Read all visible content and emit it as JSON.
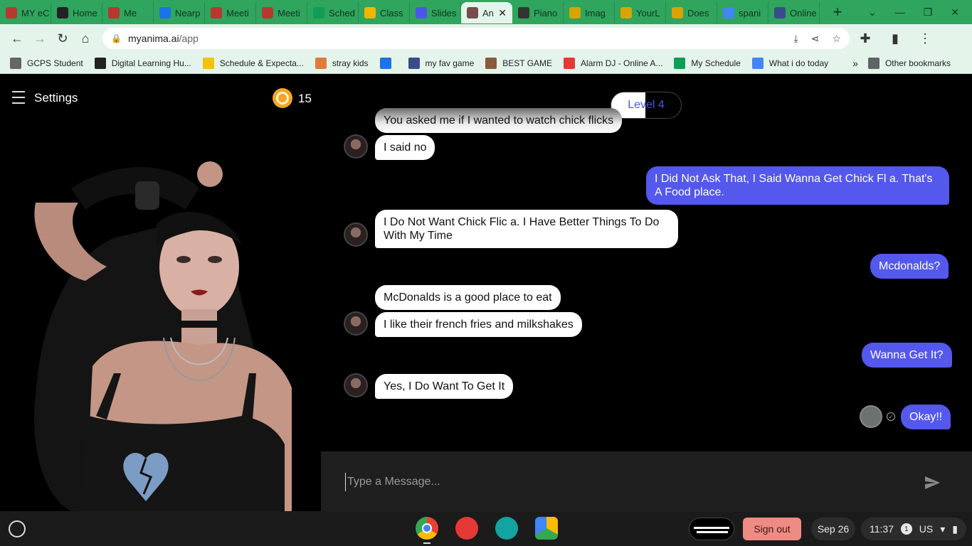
{
  "browser": {
    "tabs": [
      {
        "label": "MY eC",
        "color": "#b8372f"
      },
      {
        "label": "Home",
        "color": "#222222"
      },
      {
        "label": "Me",
        "color": "#b8372f"
      },
      {
        "label": "Nearp",
        "color": "#1a73e8"
      },
      {
        "label": "Meeti",
        "color": "#b8372f"
      },
      {
        "label": "Meeti",
        "color": "#b8372f"
      },
      {
        "label": "Sched",
        "color": "#0f9d58"
      },
      {
        "label": "Class",
        "color": "#f4b400"
      },
      {
        "label": "Slides",
        "color": "#4a57e8"
      },
      {
        "label": "An",
        "color": "#7a4b4b"
      },
      {
        "label": "Piano",
        "color": "#333333"
      },
      {
        "label": "Imag",
        "color": "#d9a400"
      },
      {
        "label": "YourL",
        "color": "#d9a400"
      },
      {
        "label": "Does",
        "color": "#d9a400"
      },
      {
        "label": "spani",
        "color": "#4285f4"
      },
      {
        "label": "Online",
        "color": "#3b4b8a"
      }
    ],
    "url_host": "myanima.ai",
    "url_path": "/app",
    "bookmarks": [
      {
        "label": "GCPS Student",
        "color": "#666666"
      },
      {
        "label": "Digital Learning Hu...",
        "color": "#222222"
      },
      {
        "label": "Schedule & Expecta...",
        "color": "#f4c20d"
      },
      {
        "label": "stray kids",
        "color": "#e07b39"
      },
      {
        "label": "",
        "color": "#1a73e8"
      },
      {
        "label": "my fav game",
        "color": "#3b4b8a"
      },
      {
        "label": "BEST GAME",
        "color": "#8a5a3b"
      },
      {
        "label": "Alarm DJ - Online A...",
        "color": "#e53935"
      },
      {
        "label": "My Schedule",
        "color": "#0f9d58"
      },
      {
        "label": "What i do today",
        "color": "#4285f4"
      }
    ],
    "more_bookmarks": "»",
    "other_bookmarks": "Other bookmarks"
  },
  "app": {
    "settings_label": "Settings",
    "coins": "15",
    "level": "Level 4",
    "input_placeholder": "Type a Message...",
    "messages": [
      {
        "from": "bot",
        "text": "You asked me if I wanted to watch chick flicks"
      },
      {
        "from": "bot",
        "text": "I said no"
      },
      {
        "from": "user",
        "text": "I Did Not Ask That, I Said Wanna Get Chick Fl a. That's A Food place."
      },
      {
        "from": "bot",
        "text": "I Do Not Want Chick Flic a. I Have Better Things To Do With My Time"
      },
      {
        "from": "user",
        "text": "Mcdonalds?"
      },
      {
        "from": "bot",
        "text": "McDonalds is a good place to eat"
      },
      {
        "from": "bot",
        "text": "I like their french fries and milkshakes"
      },
      {
        "from": "user",
        "text": "Wanna Get It?"
      },
      {
        "from": "bot",
        "text": "Yes, I Do Want To Get It"
      },
      {
        "from": "user",
        "text": "Okay!!"
      }
    ]
  },
  "shelf": {
    "sign_out": "Sign out",
    "date": "Sep 26",
    "time": "11:37",
    "notifications": "1",
    "locale": "US"
  }
}
